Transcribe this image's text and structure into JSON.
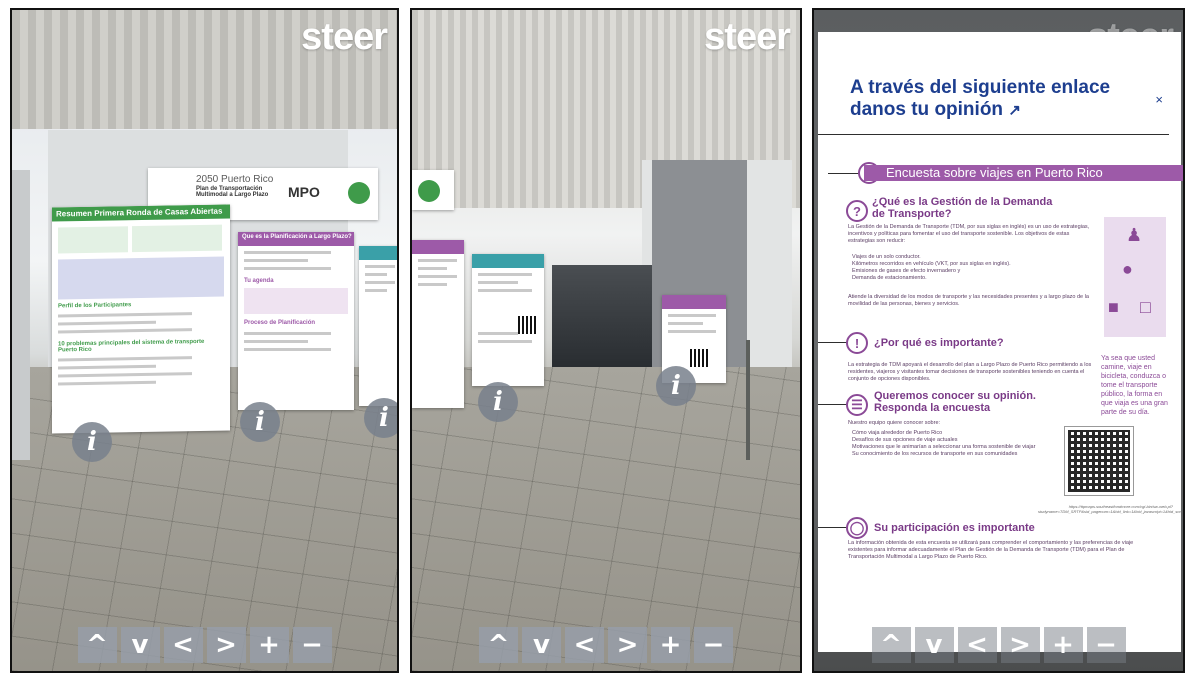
{
  "brand": {
    "logo_text": "steer"
  },
  "panels": [
    {
      "id": "view-1",
      "info_label": "i"
    },
    {
      "id": "view-2",
      "info_label": "i"
    },
    {
      "id": "view-3"
    }
  ],
  "posters": {
    "banner": {
      "line1": "2050 Puerto Rico",
      "line2": "Plan de Transportación Multimodal a Largo Plazo",
      "org": "MPO"
    },
    "left_main": {
      "title": "Resumen Primera Ronda de Casas Abiertas",
      "section1": "Perfil de los Participantes",
      "section2": "10 problemas principales del sistema de transporte Puerto Rico"
    },
    "purple_1": {
      "title": "Que es la Planificación a Largo Plazo?",
      "section": "Tu agenda",
      "section2": "Proceso de Planificación"
    }
  },
  "nav": {
    "up": "^",
    "down": "v",
    "left": "<",
    "right": ">",
    "zoom_in": "+",
    "zoom_out": "−"
  },
  "modal": {
    "title": "A través del siguiente enlace danos tu opinión",
    "close": "×",
    "survey_header": "Encuesta sobre viajes en Puerto Rico",
    "q1_title": "¿Qué es la Gestión de la Demanda de Transporte?",
    "q1_body_bold": "Gestión de la Demanda de Transporte",
    "q1_body": "La Gestión de la Demanda de Transporte (TDM, por sus siglas en inglés) es un uso de estrategias, incentivos y políticas para fomentar el uso del transporte sostenible. Los objetivos de estas estrategias son reducir:",
    "q1_bullets": [
      "Viajes de un solo conductor.",
      "Kilómetros recorridos en vehículo (VKT, por sus siglas en inglés).",
      "Emisiones de gases de efecto invernadero y",
      "Demanda de estacionamiento."
    ],
    "q1_footer": "Atiende la diversidad de los modos de transporte y las necesidades presentes y a largo plazo de la movilidad de las personas, bienes y servicios.",
    "side_text": "Ya sea que usted camine, viaje en bicicleta, conduzca o tome el transporte público, la forma en que viaja es una gran parte de su día.",
    "q2_title": "¿Por qué es importante?",
    "q2_body": "La estrategia de TDM apoyará el desarrollo del plan a Largo Plazo de Puerto Rico permitiendo a los residentes, viajeros y visitantes tomar decisiones de transporte sostenibles teniendo en cuenta el conjunto de opciones disponibles.",
    "q3_title": "Queremos conocer su opinión. Responda la encuesta",
    "q3_intro": "Nuestro equipo quiere conocer sobre:",
    "q3_bullets": [
      "Cómo viaja alrededor de Puerto Rico",
      "Desafíos de sus opciones de viaje actuales",
      "Motivaciones que le animarían a seleccionar una forma sostenible de viajar",
      "Su conocimiento de los recursos de transporte en sus comunidades"
    ],
    "qr_url": "https://ttpmaps.southeastfondmore.com/cgi-bin/sw-web.pl?studyname=TDM_SRTP&sid_pagenum=1&hid_link=1&hid_javascript=1&hid_screenwidth=1280",
    "q4_title": "Su participación es importante",
    "q4_body": "La información obtenida de esta encuesta se utilizará para comprender el comportamiento y las preferencias de viaje existentes para informar adecuadamente el Plan de Gestión de la Demanda de Transporte (TDM) para el Plan de Transportación Multimodal a Largo Plazo de Puerto Rico."
  },
  "colors": {
    "brand_blue": "#1d3e8f",
    "purple": "#9d5aa8",
    "green": "#3f9b4a"
  }
}
